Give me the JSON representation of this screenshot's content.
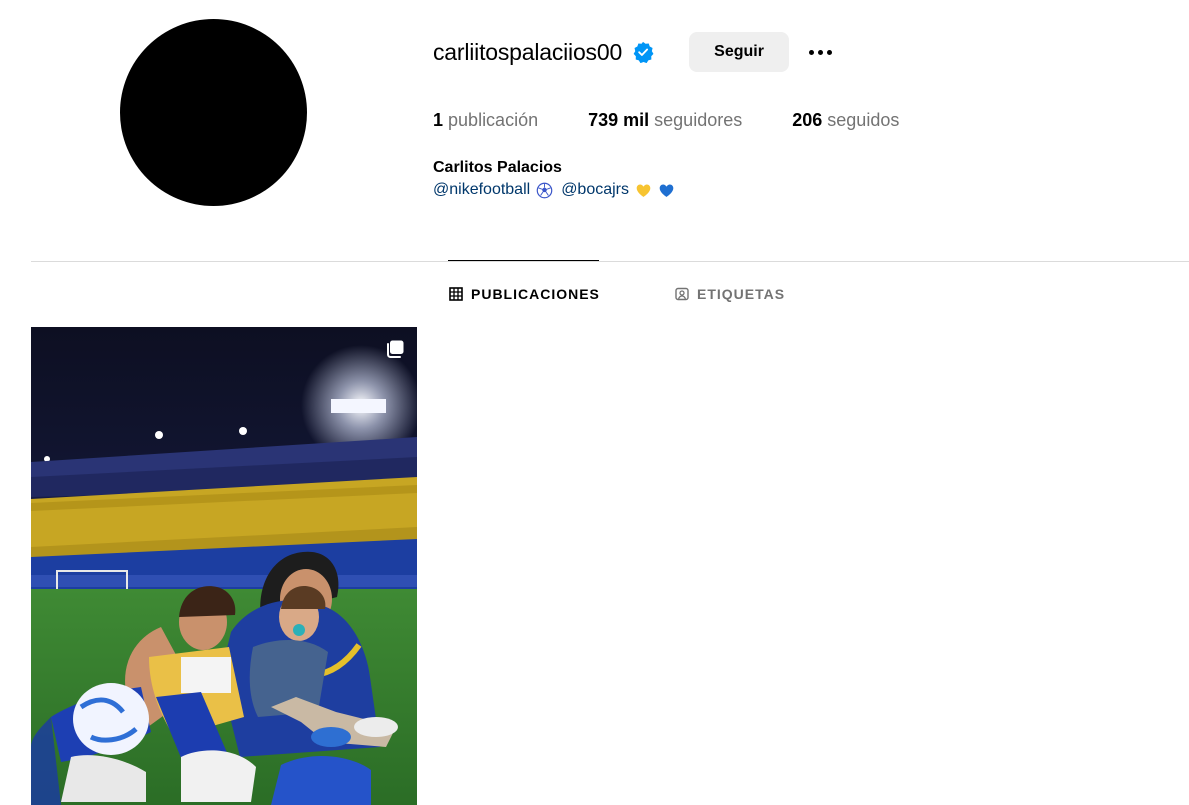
{
  "profile": {
    "username": "carliitospalaciios00",
    "verified": true,
    "follow_label": "Seguir",
    "more_icon": "more-horizontal-icon",
    "full_name": "Carlitos Palacios",
    "bio_mention_1": "@nikefootball",
    "bio_emoji_1": "soccer-ball-icon",
    "bio_mention_2": "@bocajrs",
    "bio_emoji_2": "yellow-heart-icon",
    "bio_emoji_3": "blue-heart-icon"
  },
  "stats": {
    "posts_num": "1",
    "posts_label": "publicación",
    "followers_num": "739 mil",
    "followers_label": "seguidores",
    "following_num": "206",
    "following_label": "seguidos"
  },
  "tabs": [
    {
      "label": "PUBLICACIONES",
      "icon": "grid-icon",
      "active": true
    },
    {
      "label": "ETIQUETAS",
      "icon": "tagged-icon",
      "active": false
    }
  ],
  "posts": [
    {
      "type": "carousel",
      "icon": "carousel-icon"
    }
  ],
  "colors": {
    "verified": "#0095f6",
    "link": "#00376b",
    "button_bg": "#efefef",
    "muted": "#737373",
    "divider": "#dbdbdb"
  }
}
